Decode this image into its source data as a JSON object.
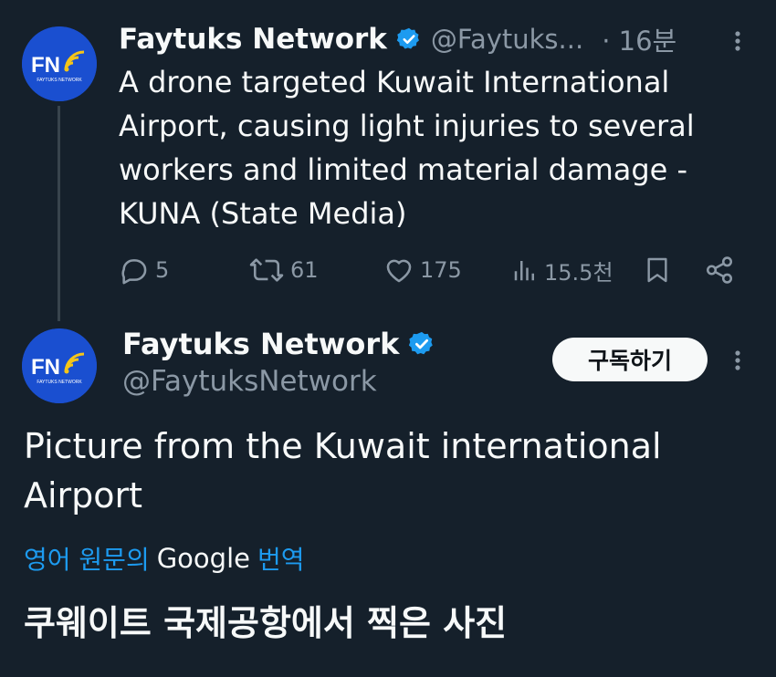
{
  "tweet1": {
    "avatar_text": "FN",
    "avatar_subtext": "FAYTUKS NETWORK",
    "author_name": "Faytuks Network",
    "verified_icon": "verified-badge-icon",
    "handle": "@Faytuks...",
    "time": "· 16분",
    "text": "A drone targeted Kuwait International Airport, causing light injuries to several workers and limited material damage - KUNA (State Media)",
    "actions": {
      "reply_count": "5",
      "retweet_count": "61",
      "like_count": "175",
      "views_count": "15.5천"
    }
  },
  "tweet2": {
    "avatar_text": "FN",
    "avatar_subtext": "FAYTUKS NETWORK",
    "author_name": "Faytuks Network",
    "handle": "@FaytuksNetwork",
    "subscribe_label": "구독하기",
    "text": "Picture from the Kuwait international Airport",
    "translate_prefix": "영어 원문의",
    "translate_google": "Google",
    "translate_suffix": "번역",
    "translated_text": "쿠웨이트 국제공항에서 찍은 사진"
  },
  "colors": {
    "background": "#15202b",
    "text_primary": "#f7f9f9",
    "text_secondary": "#8b98a5",
    "accent": "#1d9bf0",
    "avatar_bg": "#1a4fd0"
  }
}
